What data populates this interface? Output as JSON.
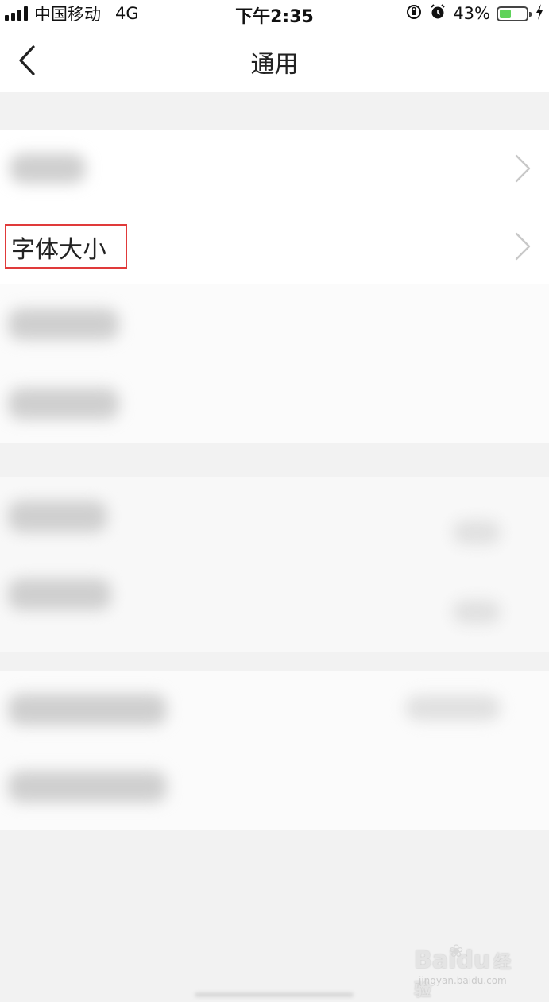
{
  "status_bar": {
    "carrier": "中国移动",
    "network": "4G",
    "time": "下午2:35",
    "battery_percent": "43%",
    "battery_level": 0.43,
    "icons": [
      "signal-icon",
      "rotation-lock-icon",
      "alarm-icon",
      "battery-icon",
      "charging-icon"
    ]
  },
  "nav": {
    "title": "通用",
    "back_icon": "chevron-left-icon"
  },
  "settings": {
    "font_size_label": "字体大小"
  },
  "watermark": {
    "brand": "Baidu",
    "brand_cn": "经验",
    "url": "jingyan.baidu.com"
  },
  "colors": {
    "highlight": "#e03a3a",
    "battery_fill": "#5fd35a"
  }
}
